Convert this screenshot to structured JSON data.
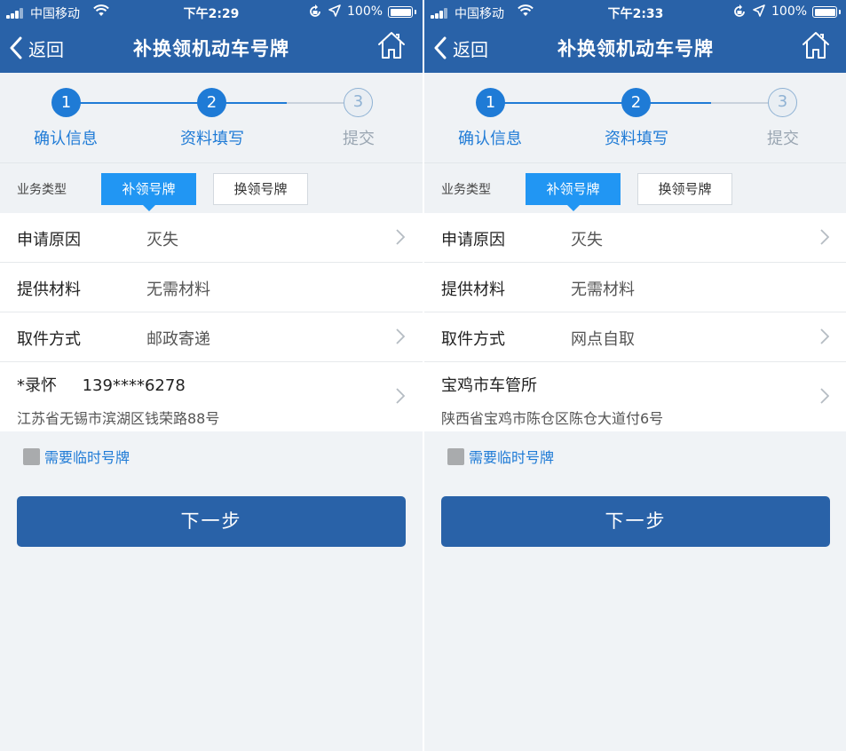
{
  "screens": [
    {
      "status": {
        "carrier": "中国移动",
        "time": "下午2:29",
        "battery": "100%"
      },
      "nav": {
        "back_label": "返回",
        "title": "补换领机动车号牌"
      },
      "steps": [
        {
          "num": "1",
          "label": "确认信息",
          "state": "done"
        },
        {
          "num": "2",
          "label": "资料填写",
          "state": "active"
        },
        {
          "num": "3",
          "label": "提交",
          "state": "pending"
        }
      ],
      "business": {
        "label": "业务类型",
        "options": [
          "补领号牌",
          "换领号牌"
        ],
        "selected": "补领号牌"
      },
      "rows": [
        {
          "label": "申请原因",
          "value": "灭失"
        },
        {
          "label": "提供材料",
          "value": "无需材料"
        },
        {
          "label": "取件方式",
          "value": "邮政寄递"
        }
      ],
      "address": {
        "line1": "*录怀     139****6278",
        "line2": "江苏省无锡市滨湖区钱荣路88号"
      },
      "temp_plate": {
        "label": "需要临时号牌",
        "checked": false
      },
      "next_label": "下一步"
    },
    {
      "status": {
        "carrier": "中国移动",
        "time": "下午2:33",
        "battery": "100%"
      },
      "nav": {
        "back_label": "返回",
        "title": "补换领机动车号牌"
      },
      "steps": [
        {
          "num": "1",
          "label": "确认信息",
          "state": "done"
        },
        {
          "num": "2",
          "label": "资料填写",
          "state": "active"
        },
        {
          "num": "3",
          "label": "提交",
          "state": "pending"
        }
      ],
      "business": {
        "label": "业务类型",
        "options": [
          "补领号牌",
          "换领号牌"
        ],
        "selected": "补领号牌"
      },
      "rows": [
        {
          "label": "申请原因",
          "value": "灭失"
        },
        {
          "label": "提供材料",
          "value": "无需材料"
        },
        {
          "label": "取件方式",
          "value": "网点自取"
        }
      ],
      "address": {
        "line1": "宝鸡市车管所",
        "line2": "陕西省宝鸡市陈仓区陈仓大道付6号"
      },
      "temp_plate": {
        "label": "需要临时号牌",
        "checked": false
      },
      "next_label": "下一步"
    }
  ],
  "colors": {
    "navbar": "#2962a8",
    "accent": "#1f7bd6",
    "segment": "#2196f3",
    "background": "#f0f3f6"
  },
  "icons": [
    "signal-icon",
    "wifi-icon",
    "rotation-lock-icon",
    "location-arrow-icon",
    "battery-icon",
    "back-chevron-icon",
    "home-icon",
    "chevron-right-icon",
    "checkbox-icon"
  ]
}
